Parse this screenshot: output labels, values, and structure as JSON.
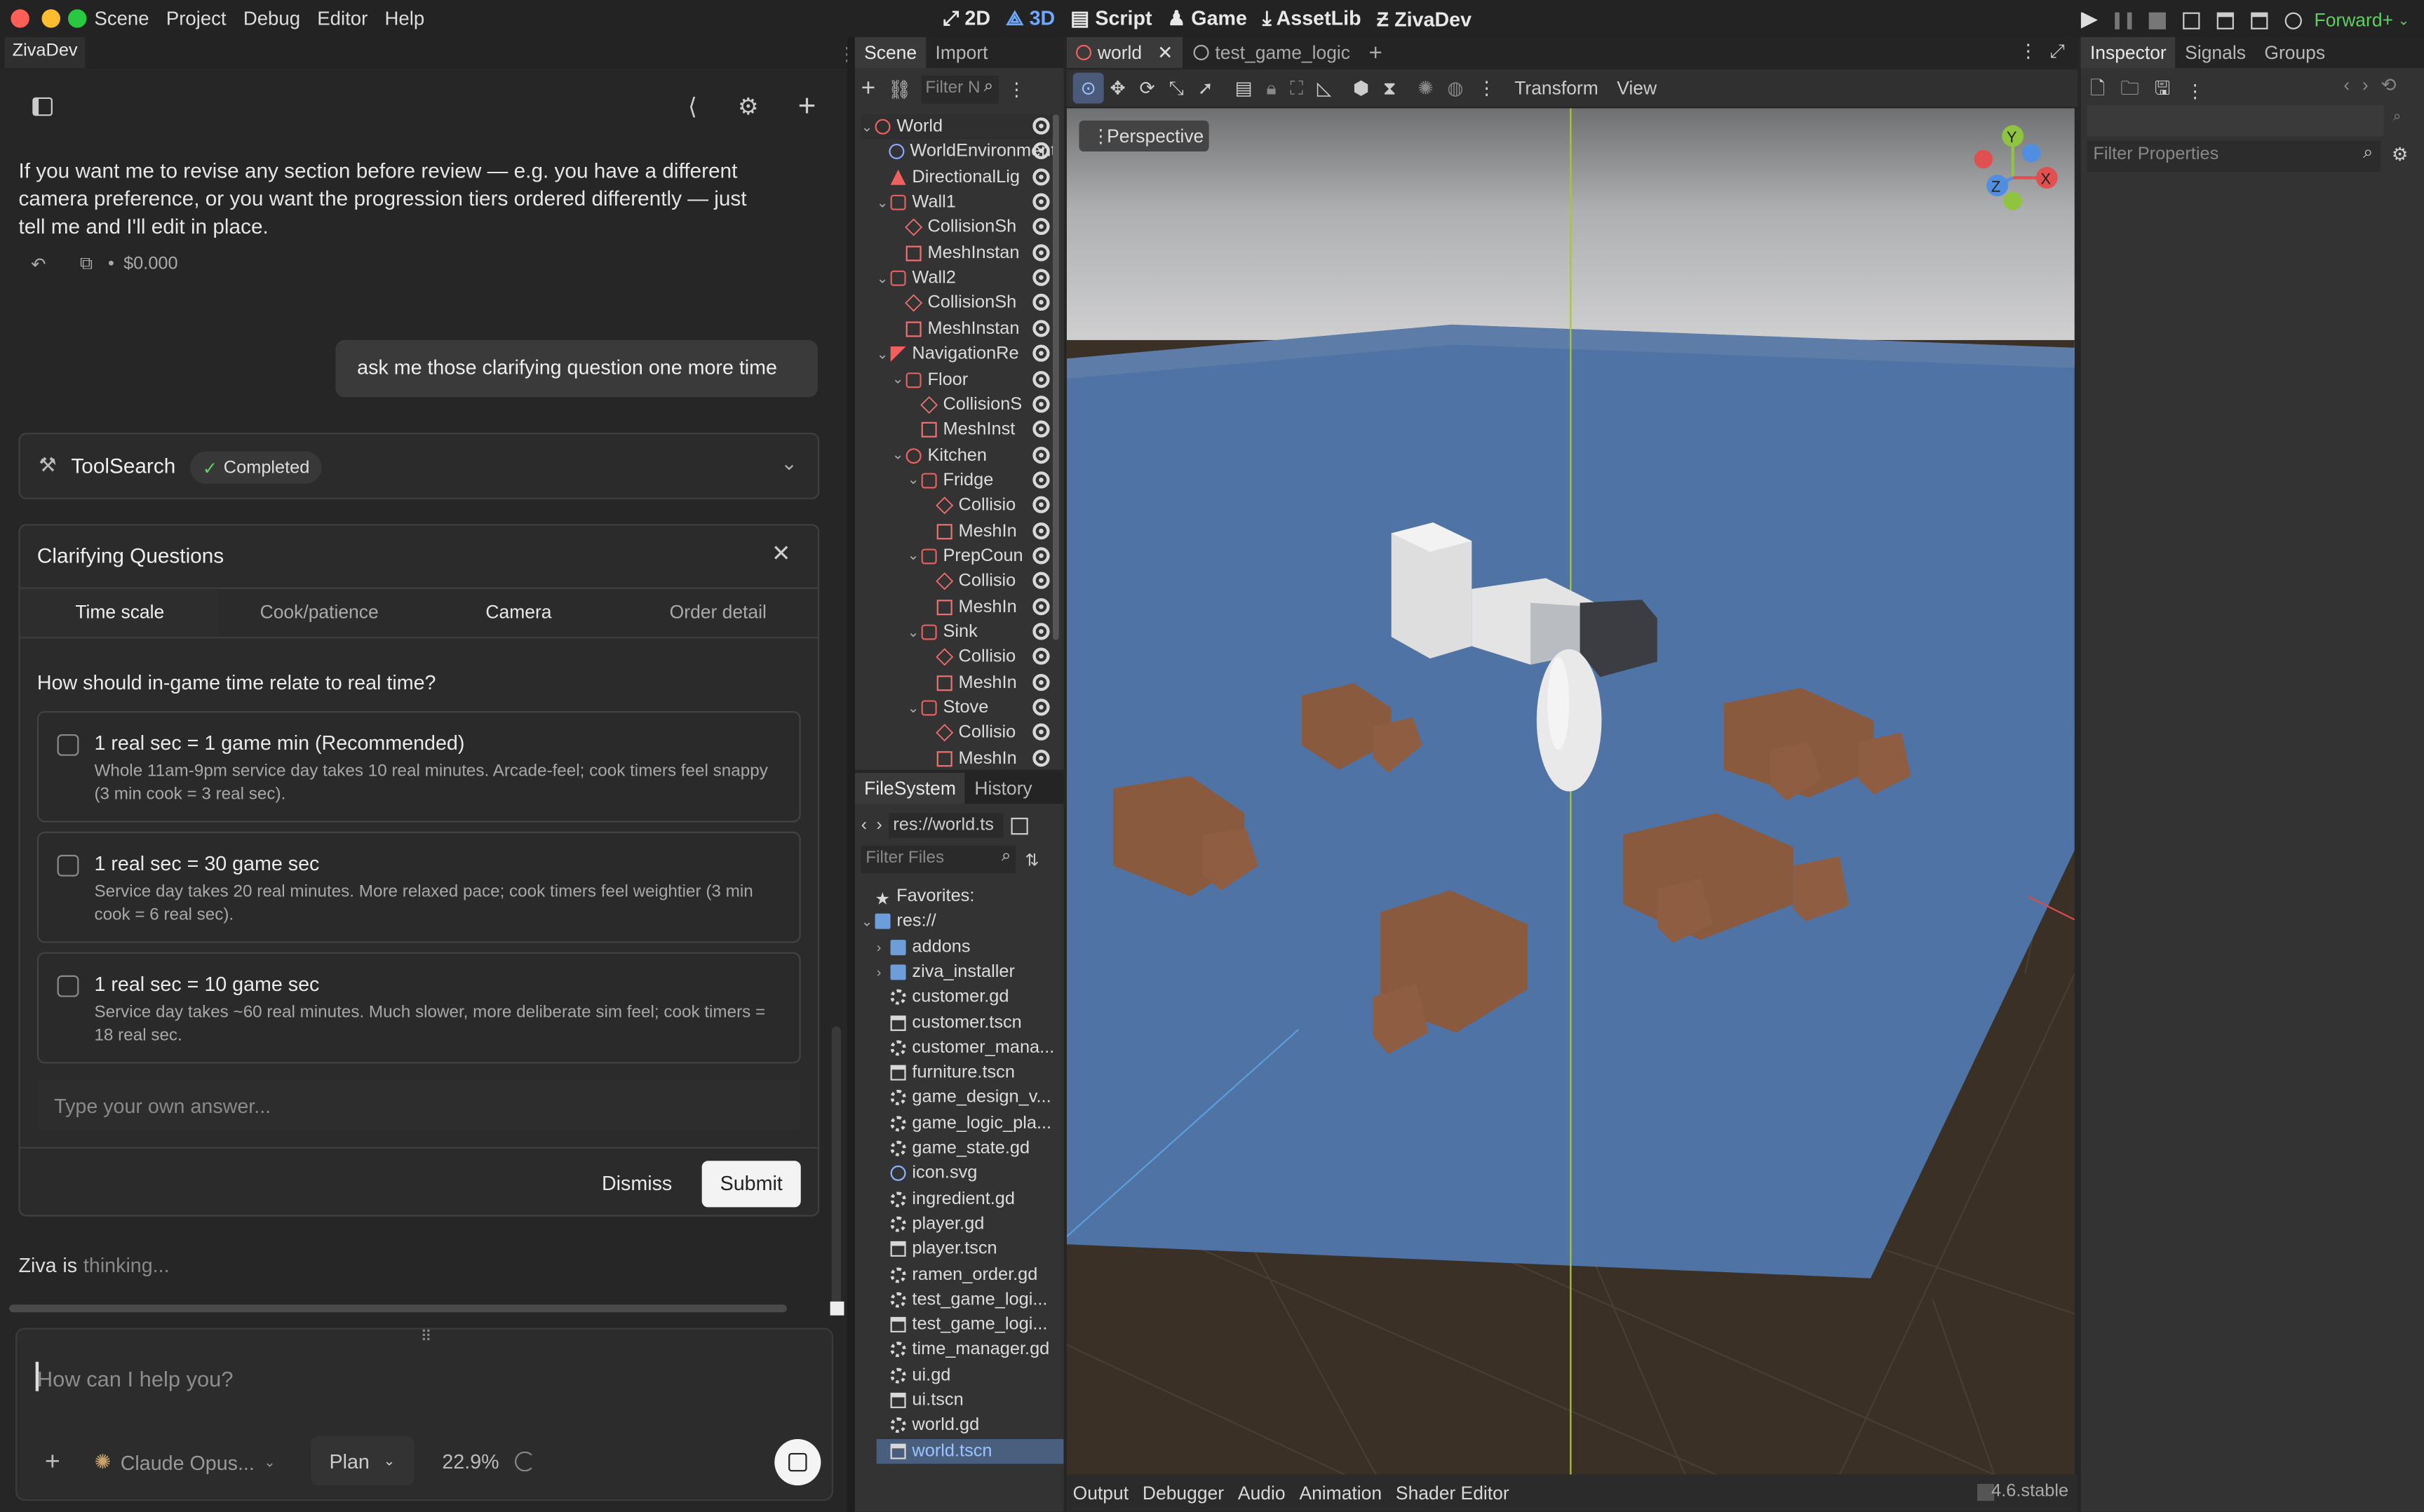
{
  "menubar": {
    "items": [
      "Scene",
      "Project",
      "Debug",
      "Editor",
      "Help"
    ],
    "modes": [
      "2D",
      "3D",
      "Script",
      "Game",
      "AssetLib",
      "ZivaDev"
    ],
    "renderer": "Forward+"
  },
  "chat": {
    "tab": "ZivaDev",
    "intro": [
      "If you want me to revise any section before review — e.g. you have a different",
      "camera preference, or you want the progression tiers ordered differently — just",
      "tell me and I'll edit in place."
    ],
    "cost": "$0.000",
    "user_message": "ask me those clarifying question one more time",
    "tool": {
      "name": "ToolSearch",
      "status": "Completed"
    },
    "questions": {
      "title": "Clarifying Questions",
      "tabs": [
        "Time scale",
        "Cook/patience",
        "Camera",
        "Order detail"
      ],
      "question": "How should in-game time relate to real time?",
      "options": [
        {
          "title": "1 real sec = 1 game min (Recommended)",
          "desc": "Whole 11am-9pm service day takes 10 real minutes. Arcade-feel; cook timers feel snappy (3 min cook = 3 real sec)."
        },
        {
          "title": "1 real sec = 30 game sec",
          "desc": "Service day takes 20 real minutes. More relaxed pace; cook timers feel weightier (3 min cook = 6 real sec)."
        },
        {
          "title": "1 real sec = 10 game sec",
          "desc": "Service day takes ~60 real minutes. Much slower, more deliberate sim feel; cook timers = 18 real sec."
        }
      ],
      "own_answer_placeholder": "Type your own answer...",
      "dismiss": "Dismiss",
      "submit": "Submit"
    },
    "status_name": "Ziva",
    "status_is": "is",
    "status_thinking": "thinking...",
    "input_placeholder": "How can I help you?",
    "model": "Claude Opus...",
    "mode": "Plan",
    "context_pct": "22.9%"
  },
  "scene": {
    "tabs": [
      "Scene",
      "Import"
    ],
    "filter_placeholder": "Filter N",
    "nodes": [
      {
        "label": "World",
        "depth": 0,
        "icon": "n3",
        "arrow": "v"
      },
      {
        "label": "WorldEnvironment",
        "depth": 1,
        "icon": "glb"
      },
      {
        "label": "DirectionalLig",
        "depth": 1,
        "icon": "dir"
      },
      {
        "label": "Wall1",
        "depth": 1,
        "icon": "cube",
        "arrow": "v"
      },
      {
        "label": "CollisionSh",
        "depth": 2,
        "icon": "col"
      },
      {
        "label": "MeshInstan",
        "depth": 2,
        "icon": "msh"
      },
      {
        "label": "Wall2",
        "depth": 1,
        "icon": "cube",
        "arrow": "v"
      },
      {
        "label": "CollisionSh",
        "depth": 2,
        "icon": "col"
      },
      {
        "label": "MeshInstan",
        "depth": 2,
        "icon": "msh"
      },
      {
        "label": "NavigationRe",
        "depth": 1,
        "icon": "nav",
        "arrow": "v"
      },
      {
        "label": "Floor",
        "depth": 2,
        "icon": "cube",
        "arrow": "v"
      },
      {
        "label": "CollisionS",
        "depth": 3,
        "icon": "col"
      },
      {
        "label": "MeshInst",
        "depth": 3,
        "icon": "msh"
      },
      {
        "label": "Kitchen",
        "depth": 2,
        "icon": "n3",
        "arrow": "v"
      },
      {
        "label": "Fridge",
        "depth": 3,
        "icon": "cube",
        "arrow": "v"
      },
      {
        "label": "Collisio",
        "depth": 4,
        "icon": "col"
      },
      {
        "label": "MeshIn",
        "depth": 4,
        "icon": "msh"
      },
      {
        "label": "PrepCoun",
        "depth": 3,
        "icon": "cube",
        "arrow": "v"
      },
      {
        "label": "Collisio",
        "depth": 4,
        "icon": "col"
      },
      {
        "label": "MeshIn",
        "depth": 4,
        "icon": "msh"
      },
      {
        "label": "Sink",
        "depth": 3,
        "icon": "cube",
        "arrow": "v"
      },
      {
        "label": "Collisio",
        "depth": 4,
        "icon": "col"
      },
      {
        "label": "MeshIn",
        "depth": 4,
        "icon": "msh"
      },
      {
        "label": "Stove",
        "depth": 3,
        "icon": "cube",
        "arrow": "v"
      },
      {
        "label": "Collisio",
        "depth": 4,
        "icon": "col"
      },
      {
        "label": "MeshIn",
        "depth": 4,
        "icon": "msh"
      }
    ]
  },
  "filesystem": {
    "tabs": [
      "FileSystem",
      "History"
    ],
    "path": "res://world.ts",
    "filter_placeholder": "Filter Files",
    "items": [
      {
        "label": "Favorites:",
        "icon": "star",
        "depth": 0
      },
      {
        "label": "res://",
        "icon": "fold",
        "depth": 0,
        "arrow": "v"
      },
      {
        "label": "addons",
        "icon": "fold",
        "depth": 1,
        "arrow": ">"
      },
      {
        "label": "ziva_installer",
        "icon": "fold",
        "depth": 1,
        "arrow": ">"
      },
      {
        "label": "customer.gd",
        "icon": "gear",
        "depth": 1
      },
      {
        "label": "customer.tscn",
        "icon": "scn",
        "depth": 1
      },
      {
        "label": "customer_mana...",
        "icon": "gear",
        "depth": 1
      },
      {
        "label": "furniture.tscn",
        "icon": "scn",
        "depth": 1
      },
      {
        "label": "game_design_v...",
        "icon": "gear",
        "depth": 1
      },
      {
        "label": "game_logic_pla...",
        "icon": "gear",
        "depth": 1
      },
      {
        "label": "game_state.gd",
        "icon": "gear",
        "depth": 1
      },
      {
        "label": "icon.svg",
        "icon": "svg",
        "depth": 1
      },
      {
        "label": "ingredient.gd",
        "icon": "gear",
        "depth": 1
      },
      {
        "label": "player.gd",
        "icon": "gear",
        "depth": 1
      },
      {
        "label": "player.tscn",
        "icon": "scn",
        "depth": 1
      },
      {
        "label": "ramen_order.gd",
        "icon": "gear",
        "depth": 1
      },
      {
        "label": "test_game_logi...",
        "icon": "gear",
        "depth": 1
      },
      {
        "label": "test_game_logi...",
        "icon": "scn",
        "depth": 1
      },
      {
        "label": "time_manager.gd",
        "icon": "gear",
        "depth": 1
      },
      {
        "label": "ui.gd",
        "icon": "gear",
        "depth": 1
      },
      {
        "label": "ui.tscn",
        "icon": "scn",
        "depth": 1
      },
      {
        "label": "world.gd",
        "icon": "gear",
        "depth": 1
      },
      {
        "label": "world.tscn",
        "icon": "scn",
        "depth": 1
      }
    ]
  },
  "editor": {
    "tabs": [
      "world",
      "test_game_logic"
    ],
    "toolbar_menus": [
      "Transform",
      "View"
    ],
    "perspective": "Perspective",
    "gizmo": {
      "x": "X",
      "y": "Y",
      "z": "Z"
    },
    "bottom_tabs": [
      "Output",
      "Debugger",
      "Audio",
      "Animation",
      "Shader Editor"
    ],
    "version": "4.6.stable"
  },
  "inspector": {
    "tabs": [
      "Inspector",
      "Signals",
      "Groups"
    ],
    "filter_placeholder": "Filter Properties"
  },
  "colors": {
    "accent": "#6fa8ff",
    "floor": "#4f73a5",
    "crate": "#8a5a3f",
    "ground": "#3b3026",
    "renderer_text": "#5fcf63"
  }
}
